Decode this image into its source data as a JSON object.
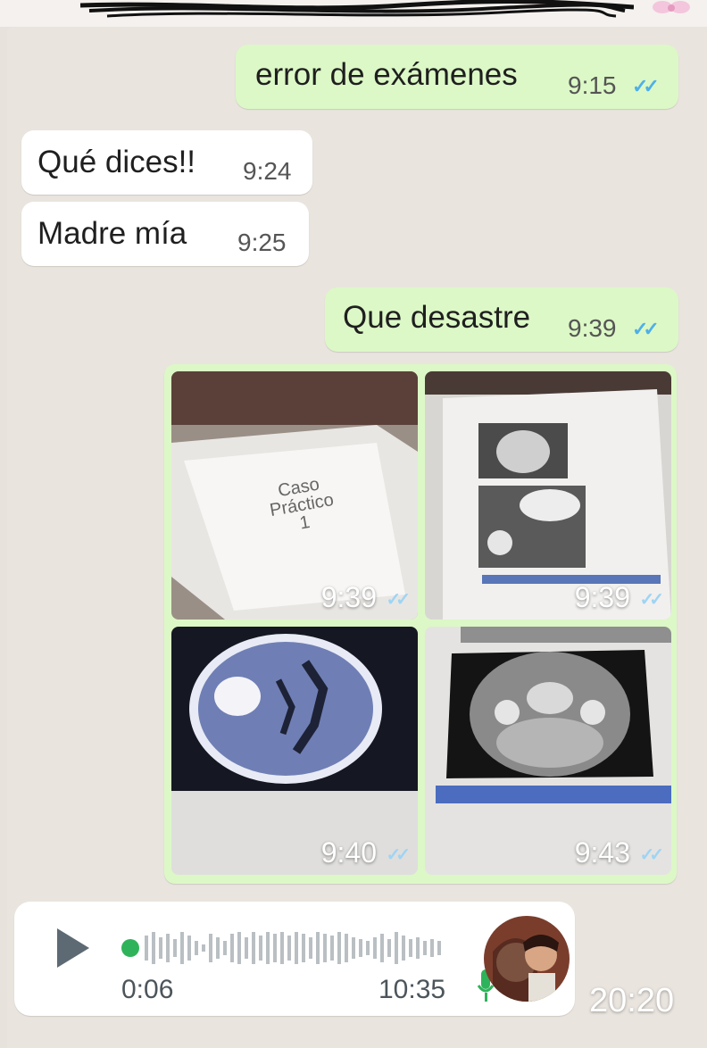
{
  "messages": [
    {
      "text": "error de exámenes",
      "time": "9:15",
      "ticks": "✓✓"
    },
    {
      "text": "Qué dices!!",
      "time": "9:24"
    },
    {
      "text": "Madre mía",
      "time": "9:25"
    },
    {
      "text": "Que desastre",
      "time": "9:39",
      "ticks": "✓✓"
    }
  ],
  "photos": [
    {
      "time": "9:39",
      "ticks": "✓✓",
      "caption": "Caso\nPráctico\n1",
      "icon": "document-photo"
    },
    {
      "time": "9:39",
      "ticks": "✓✓",
      "icon": "xray-photo"
    },
    {
      "time": "9:40",
      "ticks": "✓✓",
      "icon": "brain-ct-photo"
    },
    {
      "time": "9:43",
      "ticks": "✓✓",
      "icon": "head-ct-photo"
    }
  ],
  "voice_note": {
    "duration": "0:06",
    "time": "10:35",
    "progress": 0.0
  },
  "overlay_time": "20:20",
  "colors": {
    "outgoing": "#dcf8c6",
    "incoming": "#ffffff",
    "background": "#e9e4de",
    "ticks": "#4fb0e8",
    "voice_dot": "#2fb35a"
  }
}
